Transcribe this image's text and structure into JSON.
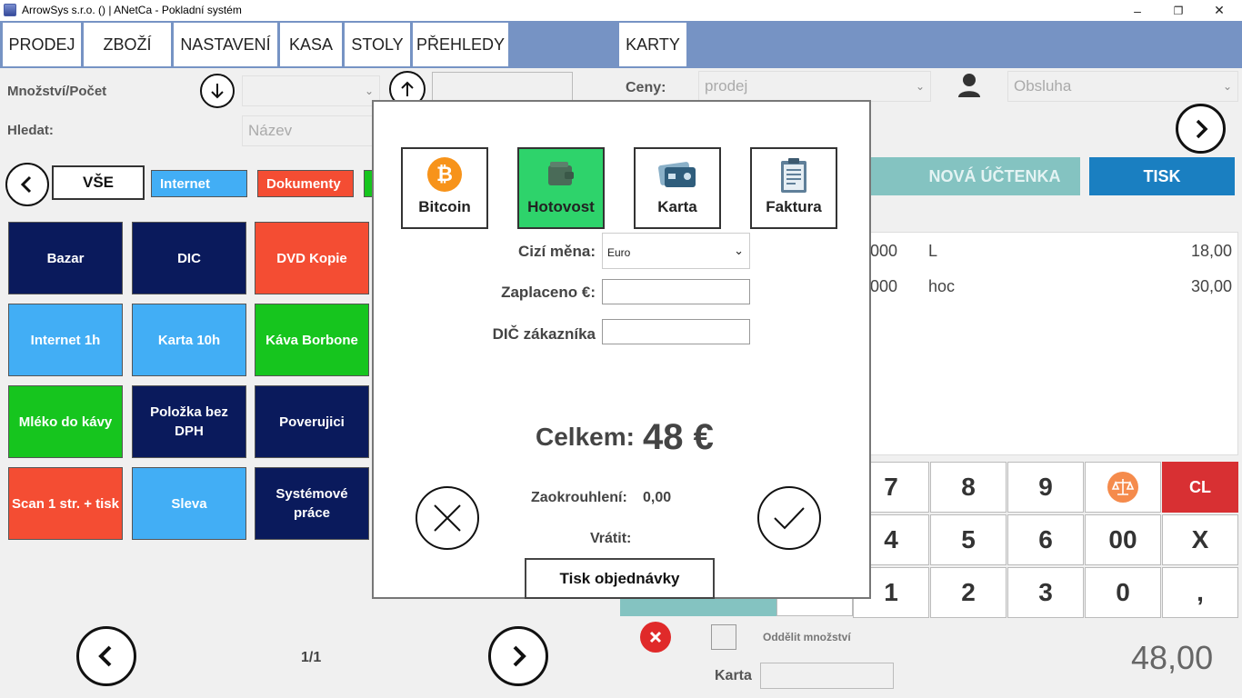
{
  "window": {
    "title": "ArrowSys s.r.o. () | ANetCa - Pokladní systém",
    "minimize": "–",
    "maximize": "❐",
    "close": "✕"
  },
  "menu": {
    "tabs": [
      "PRODEJ",
      "ZBOŽÍ",
      "NASTAVENÍ",
      "KASA",
      "STOLY",
      "PŘEHLEDY",
      "KARTY"
    ]
  },
  "controls": {
    "quantity_label": "Množství/Počet",
    "search_label": "Hledat:",
    "search_by": "Název",
    "prices_label": "Ceny:",
    "prices_value": "prodej",
    "service_placeholder": "Obsluha"
  },
  "categories": [
    {
      "label": "VŠE",
      "color": "#ffffff"
    },
    {
      "label": "Internet",
      "color": "#42aef5"
    },
    {
      "label": "Dokumenty",
      "color": "#f44d33"
    }
  ],
  "products": [
    {
      "label": "Bazar",
      "color": "navy"
    },
    {
      "label": "DIC",
      "color": "navy"
    },
    {
      "label": "DVD Kopie",
      "color": "red"
    },
    {
      "label": "Internet 1h",
      "color": "blue"
    },
    {
      "label": "Karta 10h",
      "color": "blue"
    },
    {
      "label": "Káva Borbone",
      "color": "green"
    },
    {
      "label": "Mléko do kávy",
      "color": "green"
    },
    {
      "label": "Položka bez DPH",
      "color": "navy"
    },
    {
      "label": "Poverujici",
      "color": "navy"
    },
    {
      "label": "Scan 1 str. + tisk",
      "color": "red"
    },
    {
      "label": "Sleva",
      "color": "blue"
    },
    {
      "label": "Systémové práce",
      "color": "navy"
    }
  ],
  "pagination": {
    "page": "1/1"
  },
  "receipt": {
    "new_receipt": "NOVÁ ÚČTENKA",
    "print": "TISK",
    "lines": [
      {
        "qty": "000",
        "name": "L",
        "price": "18,00"
      },
      {
        "qty": "000",
        "name": "hoc",
        "price": "30,00"
      }
    ],
    "total": "48,00",
    "split_qty_label": "Oddělit množství",
    "card_label": "Karta"
  },
  "keypad": {
    "keys": [
      "7",
      "8",
      "9",
      "",
      "CL",
      "4",
      "5",
      "6",
      "00",
      "X",
      "1",
      "2",
      "3",
      "0",
      ","
    ]
  },
  "payment": {
    "methods": [
      {
        "label": "Bitcoin",
        "icon": "bitcoin-icon"
      },
      {
        "label": "Hotovost",
        "icon": "wallet-icon"
      },
      {
        "label": "Karta",
        "icon": "credit-card-icon"
      },
      {
        "label": "Faktura",
        "icon": "invoice-icon"
      }
    ],
    "selected": "Hotovost",
    "currency_label": "Cizí měna:",
    "currency_value": "Euro",
    "paid_label": "Zaplaceno €:",
    "dic_label": "DIČ zákazníka",
    "total_label": "Celkem:",
    "total_value": "48 €",
    "rounding_label": "Zaokrouhlení:",
    "rounding_value": "0,00",
    "return_label": "Vrátit:",
    "print_order": "Tisk objednávky"
  },
  "colors": {
    "menu_bar": "#7693c4",
    "new_receipt": "#84c3c1",
    "print": "#1a7fc1",
    "clear": "#d83033",
    "selected_payment": "#2ed36b"
  }
}
